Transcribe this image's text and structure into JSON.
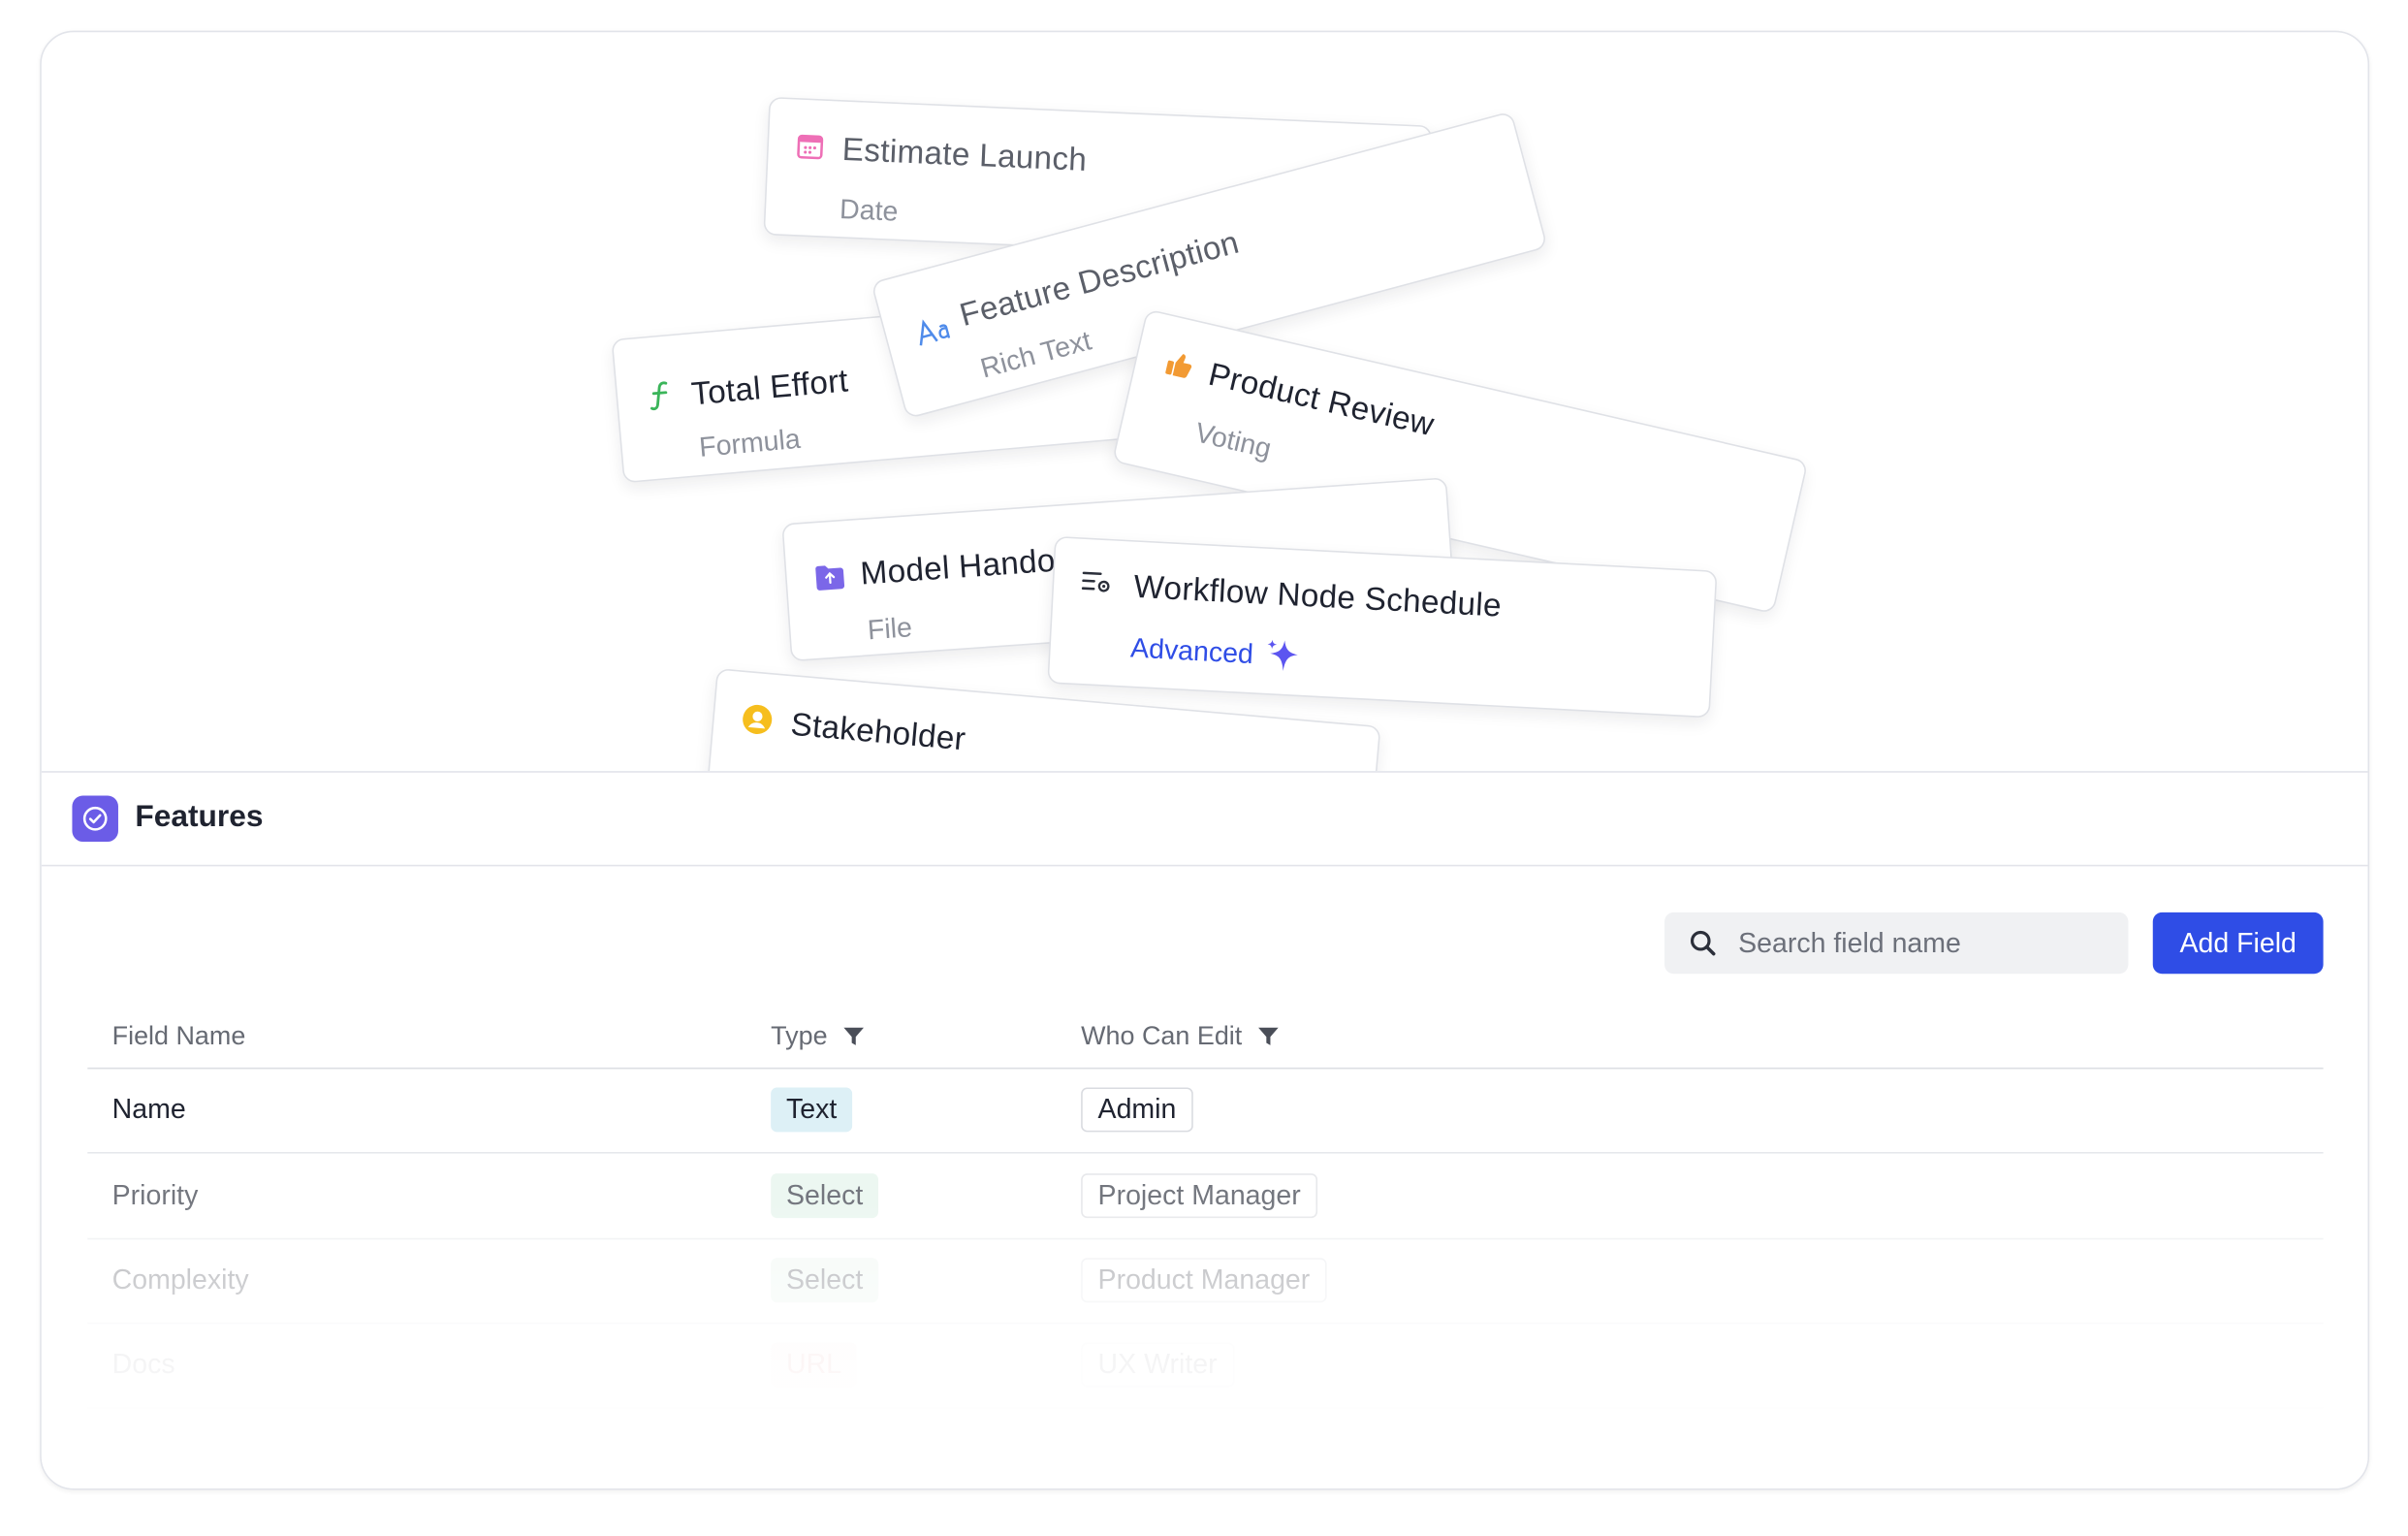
{
  "colors": {
    "accent": "#2f4de6",
    "logo": "#6b5ce7",
    "ai_advanced": "#2f4de6"
  },
  "cards": [
    {
      "title": "Estimate Launch",
      "subtitle": "Date",
      "icon": "calendar-icon"
    },
    {
      "title": "Feature Description",
      "subtitle": "Rich Text",
      "icon": "text-format-icon"
    },
    {
      "title": "Total Effort",
      "subtitle": "Formula",
      "icon": "formula-icon"
    },
    {
      "title": "Product Review",
      "subtitle": "Voting",
      "icon": "thumbs-up-icon"
    },
    {
      "title": "Model Handoff",
      "subtitle": "File",
      "icon": "file-folder-icon"
    },
    {
      "title": "Workflow Node Schedule",
      "subtitle": "Advanced",
      "icon": "workflow-settings-icon"
    },
    {
      "title": "Stakeholder",
      "subtitle": "",
      "icon": "person-icon"
    }
  ],
  "header": {
    "title": "Features",
    "icon": "check-circle-icon"
  },
  "toolbar": {
    "search_placeholder": "Search field name",
    "add_label": "Add Field"
  },
  "table": {
    "columns": [
      "Field Name",
      "Type",
      "Who Can Edit"
    ],
    "rows": [
      {
        "name": "Name",
        "type": "Text",
        "who": "Admin"
      },
      {
        "name": "Priority",
        "type": "Select",
        "who": "Project Manager"
      },
      {
        "name": "Complexity",
        "type": "Select",
        "who": "Product Manager"
      },
      {
        "name": "Docs",
        "type": "URL",
        "who": "UX Writer"
      }
    ]
  }
}
